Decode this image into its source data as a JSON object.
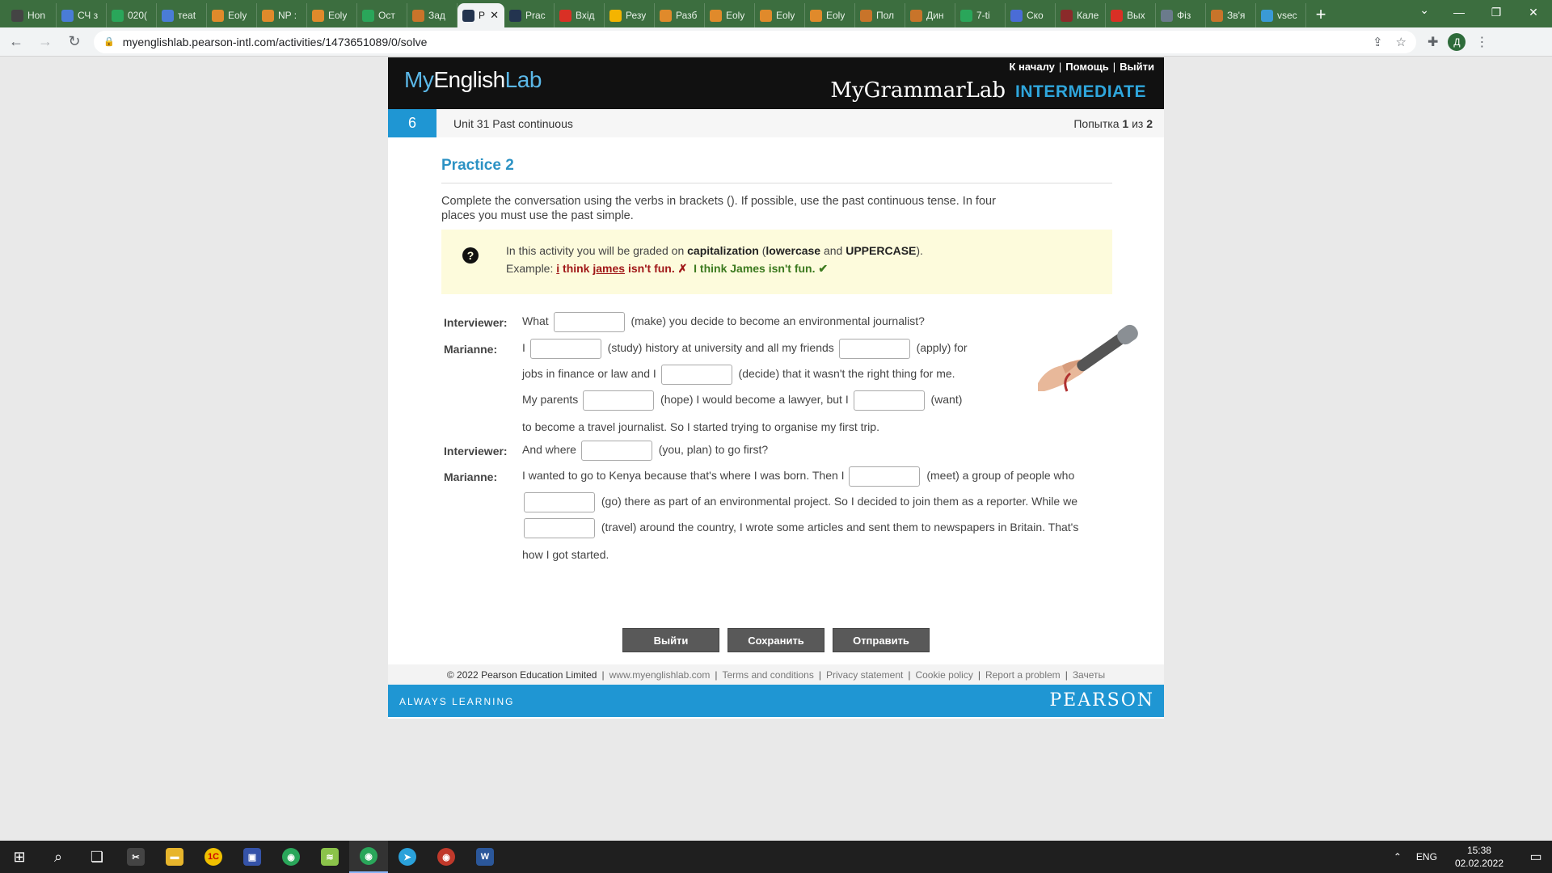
{
  "browser": {
    "tabs": [
      {
        "label": "Hon",
        "color": "#444"
      },
      {
        "label": "СЧ з",
        "color": "#4a7cd6"
      },
      {
        "label": "020(",
        "color": "#2aa65a"
      },
      {
        "label": "теаt",
        "color": "#4a7cd6"
      },
      {
        "label": "Eoly",
        "color": "#e08a2b"
      },
      {
        "label": "NP :",
        "color": "#e08a2b"
      },
      {
        "label": "Eoly",
        "color": "#e08a2b"
      },
      {
        "label": "Ост",
        "color": "#2aa65a"
      },
      {
        "label": "Зад",
        "color": "#c8742a"
      },
      {
        "label": "P",
        "color": "#23344f",
        "active": true
      },
      {
        "label": "Prac",
        "color": "#23344f"
      },
      {
        "label": "Вхід",
        "color": "#d93025"
      },
      {
        "label": "Резу",
        "color": "#f4b400"
      },
      {
        "label": "Разб",
        "color": "#e08a2b"
      },
      {
        "label": "Eoly",
        "color": "#e08a2b"
      },
      {
        "label": "Eoly",
        "color": "#e08a2b"
      },
      {
        "label": "Eoly",
        "color": "#e08a2b"
      },
      {
        "label": "Пол",
        "color": "#c8742a"
      },
      {
        "label": "Дин",
        "color": "#c8742a"
      },
      {
        "label": "7-ti",
        "color": "#2aa65a"
      },
      {
        "label": "Ско",
        "color": "#4a6cd6"
      },
      {
        "label": "Кале",
        "color": "#8b2a2a"
      },
      {
        "label": "Вых",
        "color": "#d93025"
      },
      {
        "label": "Фіз",
        "color": "#6b7b8c"
      },
      {
        "label": "Зв'я",
        "color": "#c8742a"
      },
      {
        "label": "vsec",
        "color": "#3a9ad6"
      }
    ],
    "url": "myenglishlab.pearson-intl.com/activities/1473651089/0/solve",
    "profile_initial": "Д"
  },
  "header": {
    "logo_my": "My",
    "logo_english": "English",
    "logo_lab": "Lab",
    "links": [
      "К началу",
      "Помощь",
      "Выйти"
    ],
    "product": "MyGrammarLab",
    "level": "INTERMEDIATE"
  },
  "unit": {
    "number": "6",
    "title": "Unit 31 Past continuous",
    "attempt_prefix": "Попытка",
    "attempt_current": "1",
    "attempt_of": "из",
    "attempt_total": "2"
  },
  "practice": {
    "title": "Practice 2",
    "instructions": "Complete the conversation using the verbs in brackets (). If possible, use the past continuous tense. In four places you must use the past simple.",
    "note": {
      "pre": "In this activity you will be graded on ",
      "b1": "capitalization",
      "mid1": " (",
      "b2": "lowercase",
      "mid2": " and ",
      "b3": "UPPERCASE",
      "end": ").",
      "example_label": "Example: ",
      "wrong_i": "i",
      "wrong_think": " think ",
      "wrong_james": "james",
      "wrong_rest": " isn't fun.",
      "wrong_mark": "✗",
      "right_text": "I think James isn't fun.",
      "right_mark": "✔"
    }
  },
  "dialogue": {
    "interviewer": "Interviewer:",
    "marianne": "Marianne:",
    "l1a": "What",
    "l1b": "(make) you decide to become an environmental journalist?",
    "l2a": "I",
    "l2b": "(study) history at university and all my friends",
    "l2c": "(apply) for",
    "l3a": "jobs in finance or law and I",
    "l3b": "(decide) that it wasn't the right thing for me.",
    "l4a": "My parents",
    "l4b": "(hope) I would become a lawyer, but I",
    "l4c": "(want)",
    "l5": "to become a travel journalist. So I started trying to organise my first trip.",
    "l6a": "And where",
    "l6b": "(you, plan) to go first?",
    "l7a": "I wanted to go to Kenya because that's where I was born. Then I",
    "l7b": "(meet) a group of people who",
    "l8": "(go) there as part of an environmental project. So I decided to join them as a reporter. While we",
    "l9": "(travel) around the country, I wrote some articles and sent them to newspapers in Britain. That's",
    "l10": "how I got started."
  },
  "buttons": {
    "exit": "Выйти",
    "save": "Сохранить",
    "submit": "Отправить"
  },
  "footer": {
    "copyright": "© 2022 Pearson Education Limited",
    "links": [
      "www.myenglishlab.com",
      "Terms and conditions",
      "Privacy statement",
      "Cookie policy",
      "Report a problem",
      "Зачеты"
    ],
    "tagline": "ALWAYS LEARNING",
    "brand": "PEARSON"
  },
  "taskbar": {
    "lang": "ENG",
    "time": "15:38",
    "date": "02.02.2022"
  },
  "colors": {
    "accent": "#1f96d3",
    "tab_strip": "#3c6e3f",
    "note_bg": "#fdfbdc",
    "wrong": "#a01818",
    "right": "#3c7a1f"
  }
}
